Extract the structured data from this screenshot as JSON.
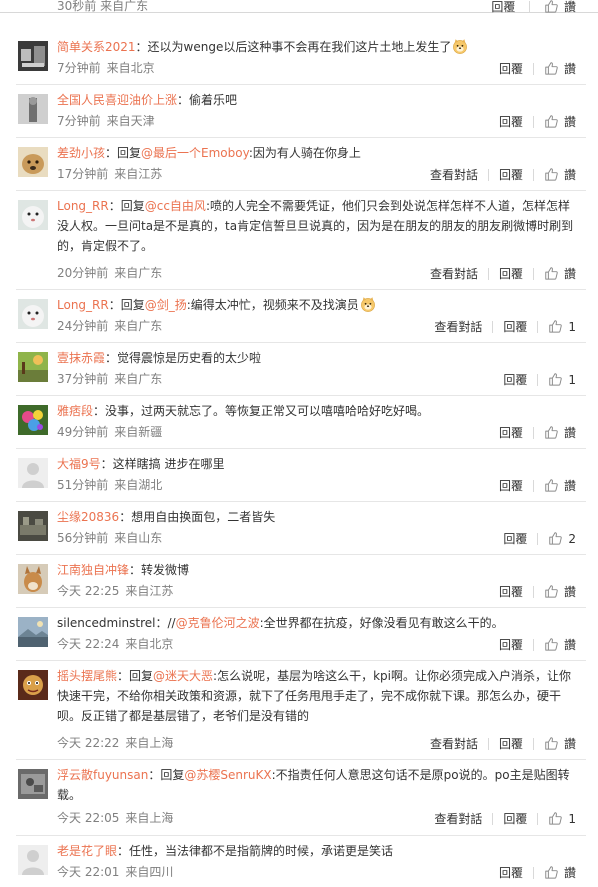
{
  "top": {
    "time": "30秒前",
    "location": "来自广东",
    "reply": "回覆",
    "like": "讚"
  },
  "icons": {
    "like": "thumbs-up-icon",
    "emoji": "doge-emoji-icon"
  },
  "colors": {
    "accent": "#eb7350",
    "meta": "#808080",
    "text": "#333333"
  },
  "comments": [
    {
      "user": "简单关系2021",
      "prefix": "",
      "mention": "",
      "text": "：还以为wenge以后这种事不会再在我们这片土地上发生了",
      "time": "7分钟前",
      "location": "来自北京",
      "view_conv": "",
      "reply": "回覆",
      "like": "讚"
    },
    {
      "user": "全国人民喜迎油价上涨",
      "prefix": "",
      "mention": "",
      "text": "：偷着乐吧",
      "time": "7分钟前",
      "location": "来自天津",
      "view_conv": "",
      "reply": "回覆",
      "like": "讚"
    },
    {
      "user": "差劲小孩",
      "prefix": "：回复",
      "mention": "@最后一个Emoboy",
      "text": ":因为有人骑在你身上",
      "time": "17分钟前",
      "location": "来自江苏",
      "view_conv": "查看對話",
      "reply": "回覆",
      "like": "讚"
    },
    {
      "user": "Long_RR",
      "prefix": "：回复",
      "mention": "@cc自由风",
      "text": ":喷的人完全不需要凭证，他们只会到处说怎样怎样不人道，怎样怎样没人权。一旦问ta是不是真的，ta肯定信誓旦旦说真的，因为是在朋友的朋友的朋友刷微博时刷到的，肯定假不了。",
      "time": "20分钟前",
      "location": "来自广东",
      "view_conv": "查看對話",
      "reply": "回覆",
      "like": "讚"
    },
    {
      "user": "Long_RR",
      "prefix": "：回复",
      "mention": "@剑_扬",
      "text": ":编得太冲忙，视频来不及找演员",
      "time": "24分钟前",
      "location": "来自广东",
      "view_conv": "查看對話",
      "reply": "回覆",
      "like": "1"
    },
    {
      "user": "壹抹赤霞",
      "prefix": "",
      "mention": "",
      "text": "：觉得震惊是历史看的太少啦",
      "time": "37分钟前",
      "location": "来自广东",
      "view_conv": "",
      "reply": "回覆",
      "like": "1"
    },
    {
      "user": "雅痞段",
      "prefix": "",
      "mention": "",
      "text": "：没事，过两天就忘了。等恢复正常又可以嘻嘻哈哈好吃好喝。",
      "time": "49分钟前",
      "location": "来自新疆",
      "view_conv": "",
      "reply": "回覆",
      "like": "讚"
    },
    {
      "user": "大福9号",
      "prefix": "",
      "mention": "",
      "text": "：这样瞎搞 进步在哪里",
      "time": "51分钟前",
      "location": "来自湖北",
      "view_conv": "",
      "reply": "回覆",
      "like": "讚"
    },
    {
      "user": "尘缘20836",
      "prefix": "",
      "mention": "",
      "text": "：想用自由换面包，二者皆失",
      "time": "56分钟前",
      "location": "来自山东",
      "view_conv": "",
      "reply": "回覆",
      "like": "2"
    },
    {
      "user": "江南独自冲锋",
      "prefix": "",
      "mention": "",
      "text": "：转发微博",
      "time": "今天 22:25",
      "location": "来自江苏",
      "view_conv": "",
      "reply": "回覆",
      "like": "讚"
    },
    {
      "user": "silencedminstrel",
      "prefix": "：//",
      "mention": "@克鲁伦河之波",
      "text": ":全世界都在抗疫，好像没看见有敢这么干的。",
      "time": "今天 22:24",
      "location": "来自北京",
      "view_conv": "",
      "reply": "回覆",
      "like": "讚"
    },
    {
      "user": "摇头摆尾熊",
      "prefix": "：回复",
      "mention": "@迷天大恶",
      "text": ":怎么说呢，基层为啥这么干，kpi啊。让你必须完成入户消杀，让你快速干完，不给你相关政策和资源，就下了任务甩甩手走了，完不成你就下课。那怎么办，硬干呗。反正错了都是基层错了，老爷们是没有错的",
      "time": "今天 22:22",
      "location": "来自上海",
      "view_conv": "查看對話",
      "reply": "回覆",
      "like": "讚"
    },
    {
      "user": "浮云散fuyunsan",
      "prefix": "：回复",
      "mention": "@苏樱SenruKX",
      "text": ":不指责任何人意思这句话不是原po说的。po主是贴图转载。",
      "time": "今天 22:05",
      "location": "来自上海",
      "view_conv": "查看對話",
      "reply": "回覆",
      "like": "1"
    },
    {
      "user": "老是花了眼",
      "prefix": "",
      "mention": "",
      "text": "：任性，当法律都不是指箭牌的时候，承诺更是笑话",
      "time": "今天 22:01",
      "location": "来自四川",
      "view_conv": "",
      "reply": "回覆",
      "like": "讚"
    }
  ]
}
